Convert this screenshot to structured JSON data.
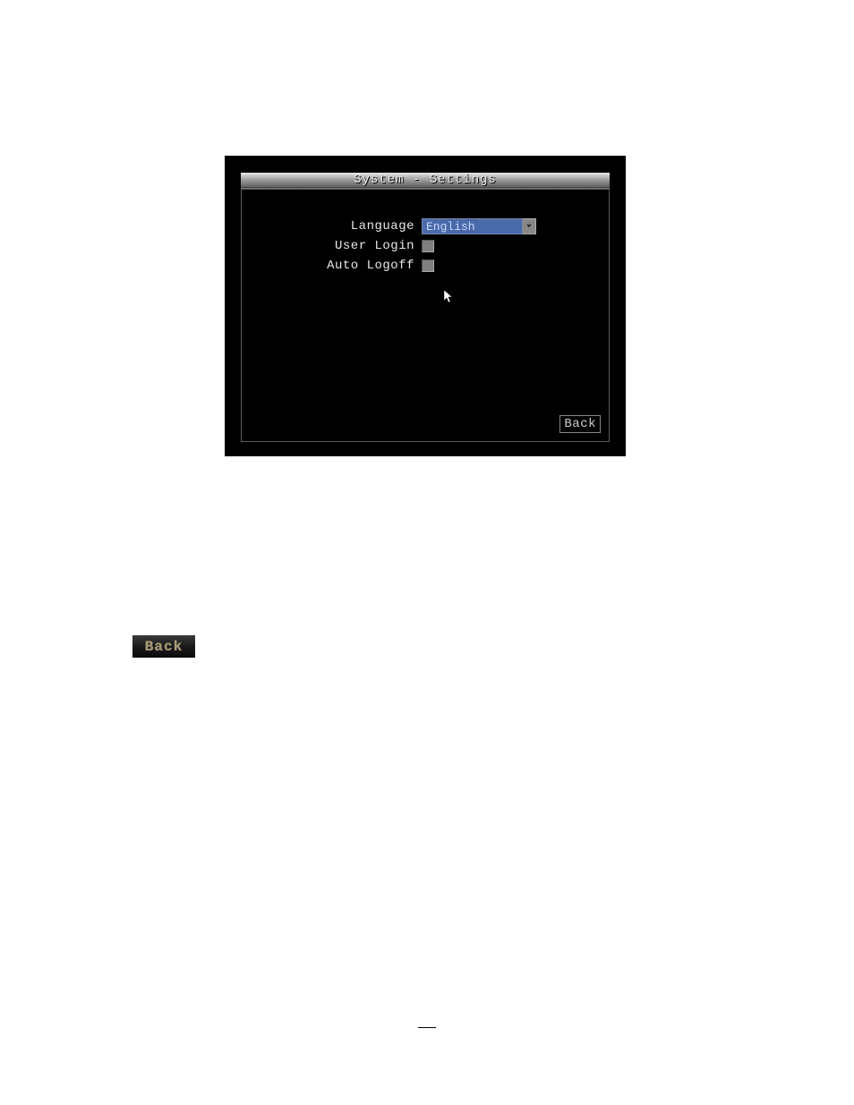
{
  "dialog": {
    "title": "System - Settings",
    "fields": {
      "language": {
        "label": "Language",
        "value": "English"
      },
      "user_login": {
        "label": "User Login",
        "checked": false
      },
      "auto_logoff": {
        "label": "Auto Logoff",
        "checked": false
      }
    },
    "buttons": {
      "back": "Back"
    }
  },
  "standalone": {
    "back_label": "Back"
  }
}
